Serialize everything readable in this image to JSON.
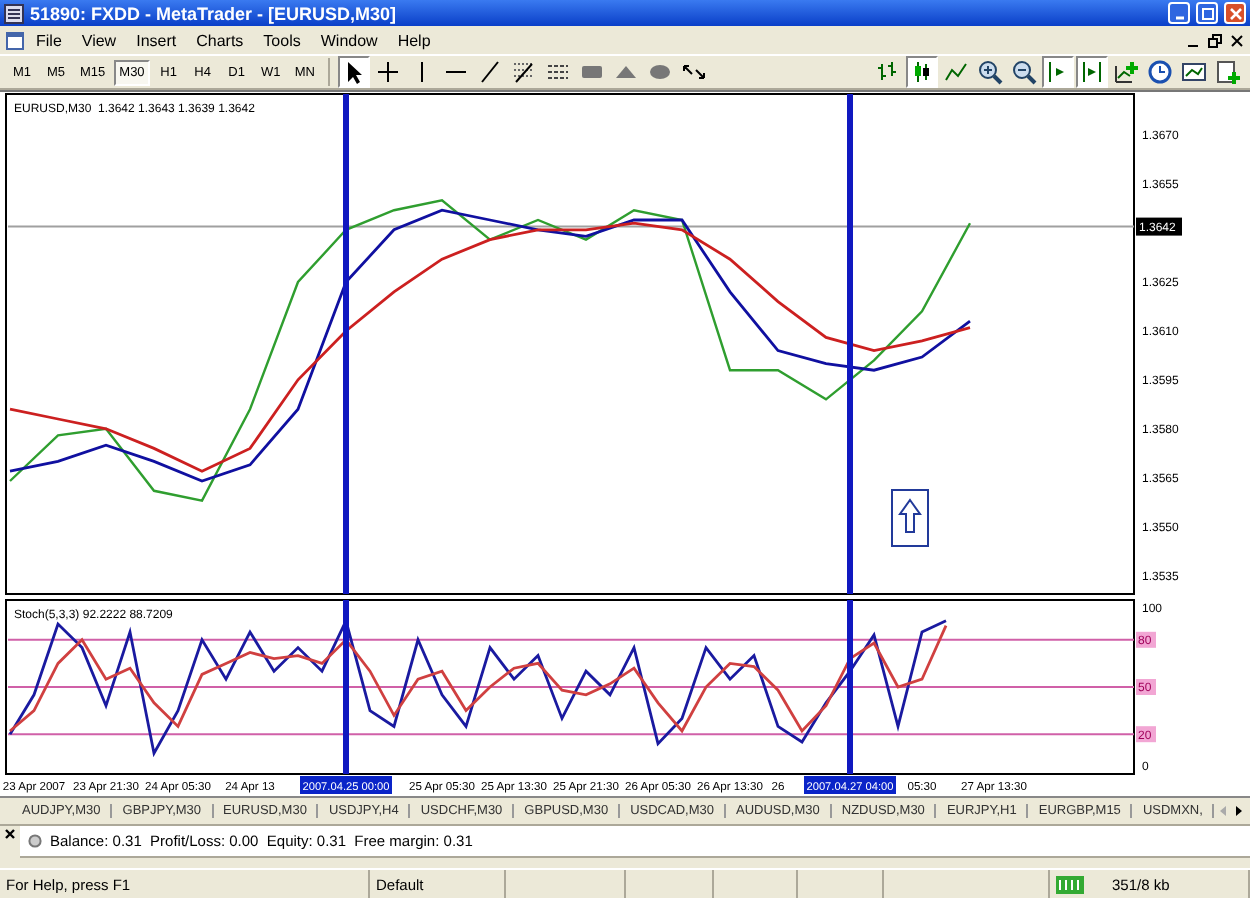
{
  "window": {
    "title": "51890: FXDD - MetaTrader - [EURUSD,M30]"
  },
  "menu": [
    "File",
    "View",
    "Insert",
    "Charts",
    "Tools",
    "Window",
    "Help"
  ],
  "periods": [
    {
      "label": "M1",
      "selected": false
    },
    {
      "label": "M5",
      "selected": false
    },
    {
      "label": "M15",
      "selected": false
    },
    {
      "label": "M30",
      "selected": true
    },
    {
      "label": "H1",
      "selected": false
    },
    {
      "label": "H4",
      "selected": false
    },
    {
      "label": "D1",
      "selected": false
    },
    {
      "label": "W1",
      "selected": false
    },
    {
      "label": "MN",
      "selected": false
    }
  ],
  "drawing_tools": [
    {
      "kind": "cursor",
      "pressed": true
    },
    {
      "kind": "crosshair",
      "pressed": false
    },
    {
      "kind": "vline",
      "pressed": false
    },
    {
      "kind": "hline",
      "pressed": false
    },
    {
      "kind": "trendline",
      "pressed": false
    },
    {
      "kind": "fibo",
      "pressed": false
    },
    {
      "kind": "channel",
      "pressed": false
    },
    {
      "kind": "rectangle",
      "pressed": false
    },
    {
      "kind": "triangle",
      "pressed": false
    },
    {
      "kind": "ellipse",
      "pressed": false
    },
    {
      "kind": "arrows",
      "pressed": false
    }
  ],
  "chart_tools": [
    {
      "kind": "bars",
      "pressed": false
    },
    {
      "kind": "candles",
      "pressed": true
    },
    {
      "kind": "line",
      "pressed": false
    },
    {
      "kind": "zoomin",
      "pressed": false
    },
    {
      "kind": "zoomout",
      "pressed": false
    },
    {
      "kind": "autoscroll",
      "pressed": true
    },
    {
      "kind": "shift",
      "pressed": true
    },
    {
      "kind": "indicators",
      "pressed": false
    },
    {
      "kind": "periods",
      "pressed": false
    },
    {
      "kind": "templates",
      "pressed": false
    },
    {
      "kind": "neworder",
      "pressed": false
    }
  ],
  "chart": {
    "header": "EURUSD,M30  1.3642 1.3643 1.3639 1.3642",
    "chart_data": {
      "type": "line",
      "categories": [
        null,
        null,
        null,
        null,
        null,
        null,
        null,
        null,
        null,
        null,
        null,
        null,
        null,
        null,
        null,
        null,
        null,
        null,
        null,
        null,
        null
      ],
      "ylim": [
        1.353,
        1.3682
      ],
      "yticks": [
        {
          "value": 1.3535,
          "label": "1.3535"
        },
        {
          "value": 1.355,
          "label": "1.3550"
        },
        {
          "value": 1.3565,
          "label": "1.3565"
        },
        {
          "value": 1.358,
          "label": "1.3580"
        },
        {
          "value": 1.3595,
          "label": "1.3595"
        },
        {
          "value": 1.361,
          "label": "1.3610"
        },
        {
          "value": 1.3625,
          "label": "1.3625"
        },
        {
          "value": 1.3655,
          "label": "1.3655"
        },
        {
          "value": 1.367,
          "label": "1.3670"
        }
      ],
      "series": [
        {
          "color": "#2f9e2f",
          "values": [
            1.3564,
            1.3578,
            1.358,
            1.3561,
            1.3558,
            1.3586,
            1.3625,
            1.3641,
            1.3647,
            1.365,
            1.3638,
            1.3644,
            1.3638,
            1.3647,
            1.3644,
            1.3598,
            1.3598,
            1.3589,
            1.3601,
            1.3616,
            1.3643
          ]
        },
        {
          "color": "#1010a0",
          "values": [
            1.3567,
            1.357,
            1.3575,
            1.357,
            1.3564,
            1.3569,
            1.3586,
            1.3625,
            1.3641,
            1.3647,
            1.3644,
            1.3641,
            1.3639,
            1.3644,
            1.3644,
            1.3622,
            1.3604,
            1.36,
            1.3598,
            1.3602,
            1.3613
          ]
        },
        {
          "color": "#cc2020",
          "values": [
            1.3586,
            1.3583,
            1.358,
            1.3574,
            1.3567,
            1.3574,
            1.3595,
            1.361,
            1.3622,
            1.3632,
            1.3638,
            1.3641,
            1.3641,
            1.3643,
            1.3641,
            1.3632,
            1.3619,
            1.3608,
            1.3604,
            1.3607,
            1.3611
          ]
        }
      ],
      "ref_lines": [
        {
          "axis": "y",
          "value": 1.3642,
          "label": "1.3642"
        }
      ]
    }
  },
  "indicator": {
    "header": "Stoch(5,3,3) 92.2222 88.7209",
    "chart_data": {
      "type": "line",
      "categories": [
        null,
        "23 Apr 2007",
        null,
        null,
        "23 Apr 21:30",
        null,
        null,
        "24 Apr 05:30",
        null,
        null,
        "24 Apr 13",
        null,
        null,
        null,
        null,
        null,
        null,
        null,
        "25 Apr 05:30",
        null,
        null,
        "25 Apr 13:30",
        null,
        null,
        "25 Apr 21:30",
        null,
        null,
        "26 Apr 05:30",
        null,
        null,
        "26 Apr 13:30",
        null,
        "26",
        null,
        null,
        null,
        null,
        null,
        "05:30",
        null,
        null,
        "27 Apr 13:30"
      ],
      "ylim": [
        -4,
        104
      ],
      "yticks": [
        {
          "value": 100,
          "label": "100"
        },
        {
          "value": 0,
          "label": "0"
        }
      ],
      "series": [
        {
          "color": "#1a1aa0",
          "values": [
            20,
            45,
            90,
            75,
            38,
            85,
            8,
            35,
            80,
            55,
            85,
            60,
            75,
            60,
            92,
            35,
            25,
            80,
            45,
            25,
            75,
            55,
            70,
            30,
            60,
            45,
            75,
            14,
            30,
            75,
            55,
            70,
            25,
            15,
            40,
            60,
            83,
            25,
            85,
            92,
            null,
            null
          ]
        },
        {
          "color": "#d04040",
          "values": [
            22,
            35,
            65,
            80,
            55,
            62,
            40,
            25,
            58,
            65,
            72,
            68,
            70,
            65,
            80,
            60,
            32,
            55,
            60,
            35,
            50,
            62,
            65,
            48,
            45,
            52,
            62,
            40,
            22,
            50,
            65,
            63,
            48,
            22,
            38,
            68,
            78,
            50,
            55,
            89,
            null,
            null
          ]
        }
      ],
      "ref_lines": [
        {
          "axis": "y",
          "value": 80,
          "label": "80"
        },
        {
          "axis": "y",
          "value": 50,
          "label": "50"
        },
        {
          "axis": "y",
          "value": 20,
          "label": "20"
        }
      ]
    },
    "cursor_dates": [
      "2007.04.25 00:00",
      "2007.04.27 04:00"
    ]
  },
  "symbol_tabs": [
    "AUDJPY,M30",
    "GBPJPY,M30",
    "EURUSD,M30",
    "USDJPY,H4",
    "USDCHF,M30",
    "GBPUSD,M30",
    "USDCAD,M30",
    "AUDUSD,M30",
    "NZDUSD,M30",
    "EURJPY,H1",
    "EURGBP,M15",
    "USDMXN,"
  ],
  "terminal": {
    "balance": "Balance: 0.31  Profit/Loss: 0.00  Equity: 0.31  Free margin: 0.31"
  },
  "status_bar": {
    "help": "For Help, press F1",
    "profile": "Default",
    "traffic": "351/8 kb"
  }
}
